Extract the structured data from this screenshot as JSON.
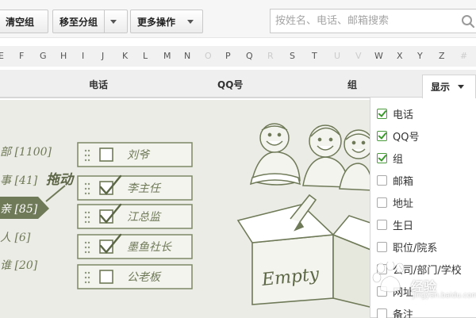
{
  "toolbar": {
    "clear_group": "清空组",
    "move_to_group": "移至分组",
    "more_actions": "更多操作"
  },
  "search": {
    "placeholder": "按姓名、电话、邮箱搜索"
  },
  "alphabet": {
    "letters": [
      "E",
      "F",
      "G",
      "H",
      "I",
      "J",
      "K",
      "L",
      "M",
      "N",
      "O",
      "P",
      "Q",
      "R",
      "S",
      "T",
      "U",
      "V",
      "W",
      "X",
      "Y",
      "Z",
      "#"
    ]
  },
  "columns": {
    "phone": "电话",
    "qq": "QQ号",
    "group": "组",
    "display": "显示"
  },
  "display_menu": {
    "options": [
      {
        "label": "电话",
        "checked": true
      },
      {
        "label": "QQ号",
        "checked": true
      },
      {
        "label": "组",
        "checked": true
      },
      {
        "label": "邮箱",
        "checked": false
      },
      {
        "label": "地址",
        "checked": false
      },
      {
        "label": "生日",
        "checked": false
      },
      {
        "label": "职位/院系",
        "checked": false
      },
      {
        "label": "公司/部门/学校",
        "checked": false
      },
      {
        "label": "网址",
        "checked": false
      },
      {
        "label": "备注",
        "checked": false
      }
    ]
  },
  "illustration": {
    "groups": [
      "部 [1100]",
      "事 [41]",
      "亲 [85]",
      "人 [6]",
      "谁 [20]"
    ],
    "drag_label": "拖动",
    "cards": [
      {
        "name": "刘爷",
        "checked": false
      },
      {
        "name": "李主任",
        "checked": true
      },
      {
        "name": "江总监",
        "checked": true
      },
      {
        "name": "墨鱼社长",
        "checked": true
      },
      {
        "name": "公老板",
        "checked": false
      }
    ],
    "empty_label": "Empty"
  },
  "watermark": {
    "text": "经验",
    "url": "jingyan.baidu.com"
  },
  "colors": {
    "sketch": "#6f7a58",
    "check_green": "#3b9a2c",
    "illustration_bg": "#ecece6"
  }
}
